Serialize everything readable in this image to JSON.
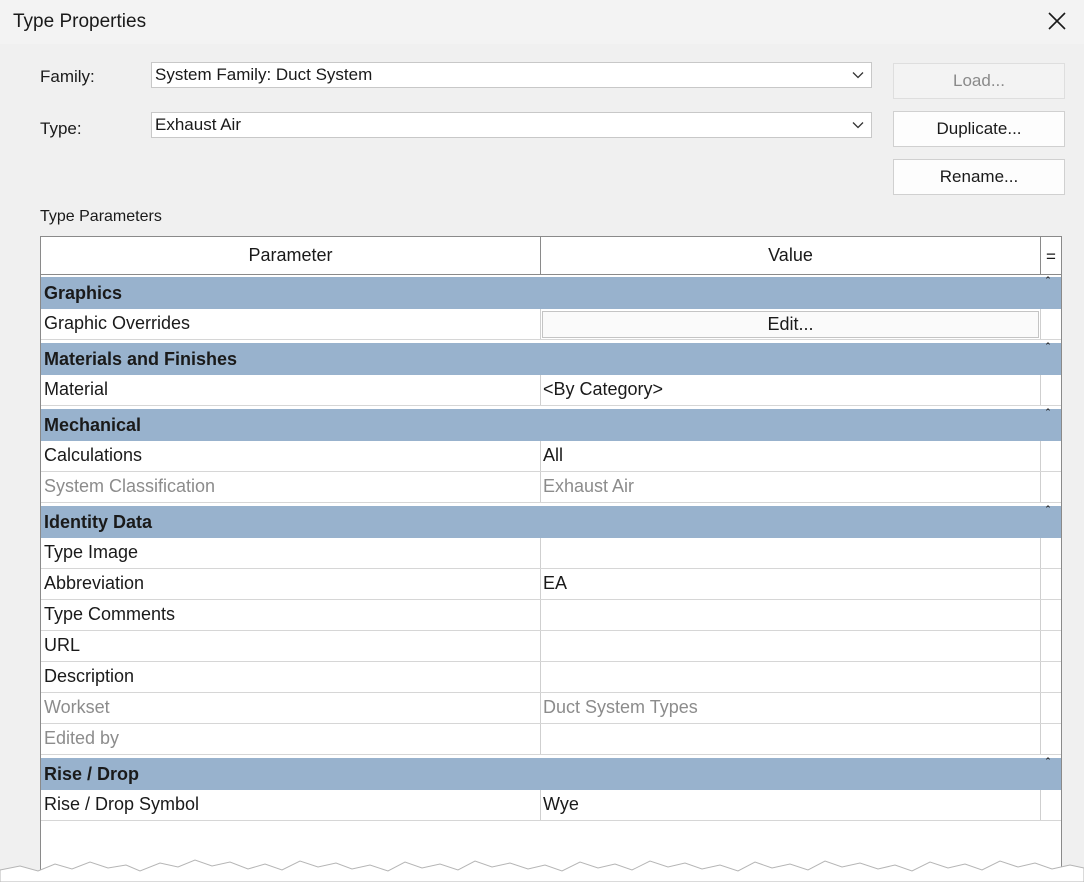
{
  "window": {
    "title": "Type Properties",
    "close_icon": "close-icon"
  },
  "family": {
    "label": "Family:",
    "value": "System Family: Duct System"
  },
  "type": {
    "label": "Type:",
    "value": "Exhaust Air"
  },
  "buttons": {
    "load": "Load...",
    "duplicate": "Duplicate...",
    "rename": "Rename..."
  },
  "section_label": "Type Parameters",
  "table": {
    "headers": {
      "parameter": "Parameter",
      "value": "Value",
      "eq": "="
    },
    "groups": [
      {
        "name": "Graphics",
        "rows": [
          {
            "param": "Graphic Overrides",
            "value": "Edit...",
            "kind": "button"
          }
        ]
      },
      {
        "name": "Materials and Finishes",
        "rows": [
          {
            "param": "Material",
            "value": "<By Category>"
          }
        ]
      },
      {
        "name": "Mechanical",
        "rows": [
          {
            "param": "Calculations",
            "value": "All"
          },
          {
            "param": "System Classification",
            "value": "Exhaust Air",
            "readonly": true
          }
        ]
      },
      {
        "name": "Identity Data",
        "rows": [
          {
            "param": "Type Image",
            "value": ""
          },
          {
            "param": "Abbreviation",
            "value": "EA"
          },
          {
            "param": "Type Comments",
            "value": ""
          },
          {
            "param": "URL",
            "value": ""
          },
          {
            "param": "Description",
            "value": ""
          },
          {
            "param": "Workset",
            "value": "Duct System Types",
            "readonly": true
          },
          {
            "param": "Edited by",
            "value": "",
            "readonly": true
          }
        ]
      },
      {
        "name": "Rise / Drop",
        "rows": [
          {
            "param": "Rise / Drop Symbol",
            "value": "Wye"
          }
        ]
      }
    ]
  },
  "colors": {
    "group_header": "#98b2cd",
    "dialog_bg": "#f0f0f0",
    "readonly_text": "#8c8c8c"
  }
}
